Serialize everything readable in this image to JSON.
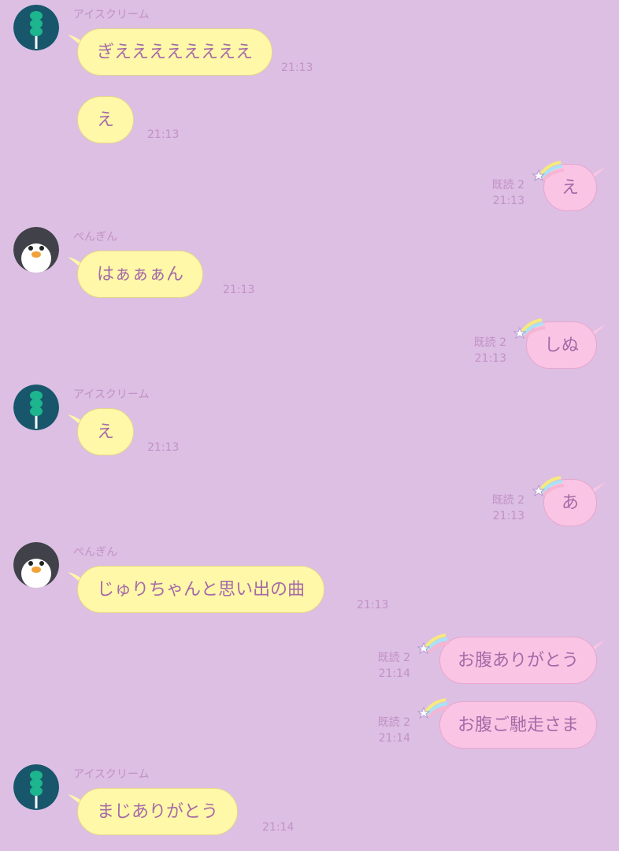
{
  "colors": {
    "background": "#dcbfe3",
    "incoming_bubble": "#fff8a8",
    "outgoing_bubble": "#fac5e4",
    "text": "#a56aa8",
    "meta_text": "#c391c5"
  },
  "messages": [
    {
      "direction": "in",
      "sender": "アイスクリーム",
      "avatar": "ice-cream-icon",
      "text": "ぎええええええええ",
      "time": "21:13"
    },
    {
      "direction": "in",
      "text": "え",
      "time": "21:13"
    },
    {
      "direction": "out",
      "text": "え",
      "read": "既読 2",
      "time": "21:13"
    },
    {
      "direction": "in",
      "sender": "ぺんぎん",
      "avatar": "penguin-icon",
      "text": "はぁぁぁん",
      "time": "21:13"
    },
    {
      "direction": "out",
      "text": "しぬ",
      "read": "既読 2",
      "time": "21:13"
    },
    {
      "direction": "in",
      "sender": "アイスクリーム",
      "avatar": "ice-cream-icon",
      "text": "え",
      "time": "21:13"
    },
    {
      "direction": "out",
      "text": "あ",
      "read": "既読 2",
      "time": "21:13"
    },
    {
      "direction": "in",
      "sender": "ぺんぎん",
      "avatar": "penguin-icon",
      "text": "じゅりちゃんと思い出の曲",
      "time": "21:13"
    },
    {
      "direction": "out",
      "text": "お腹ありがとう",
      "read": "既読 2",
      "time": "21:14"
    },
    {
      "direction": "out",
      "text": "お腹ご馳走さま",
      "read": "既読 2",
      "time": "21:14"
    },
    {
      "direction": "in",
      "sender": "アイスクリーム",
      "avatar": "ice-cream-icon",
      "text": "まじありがとう",
      "time": "21:14"
    }
  ]
}
